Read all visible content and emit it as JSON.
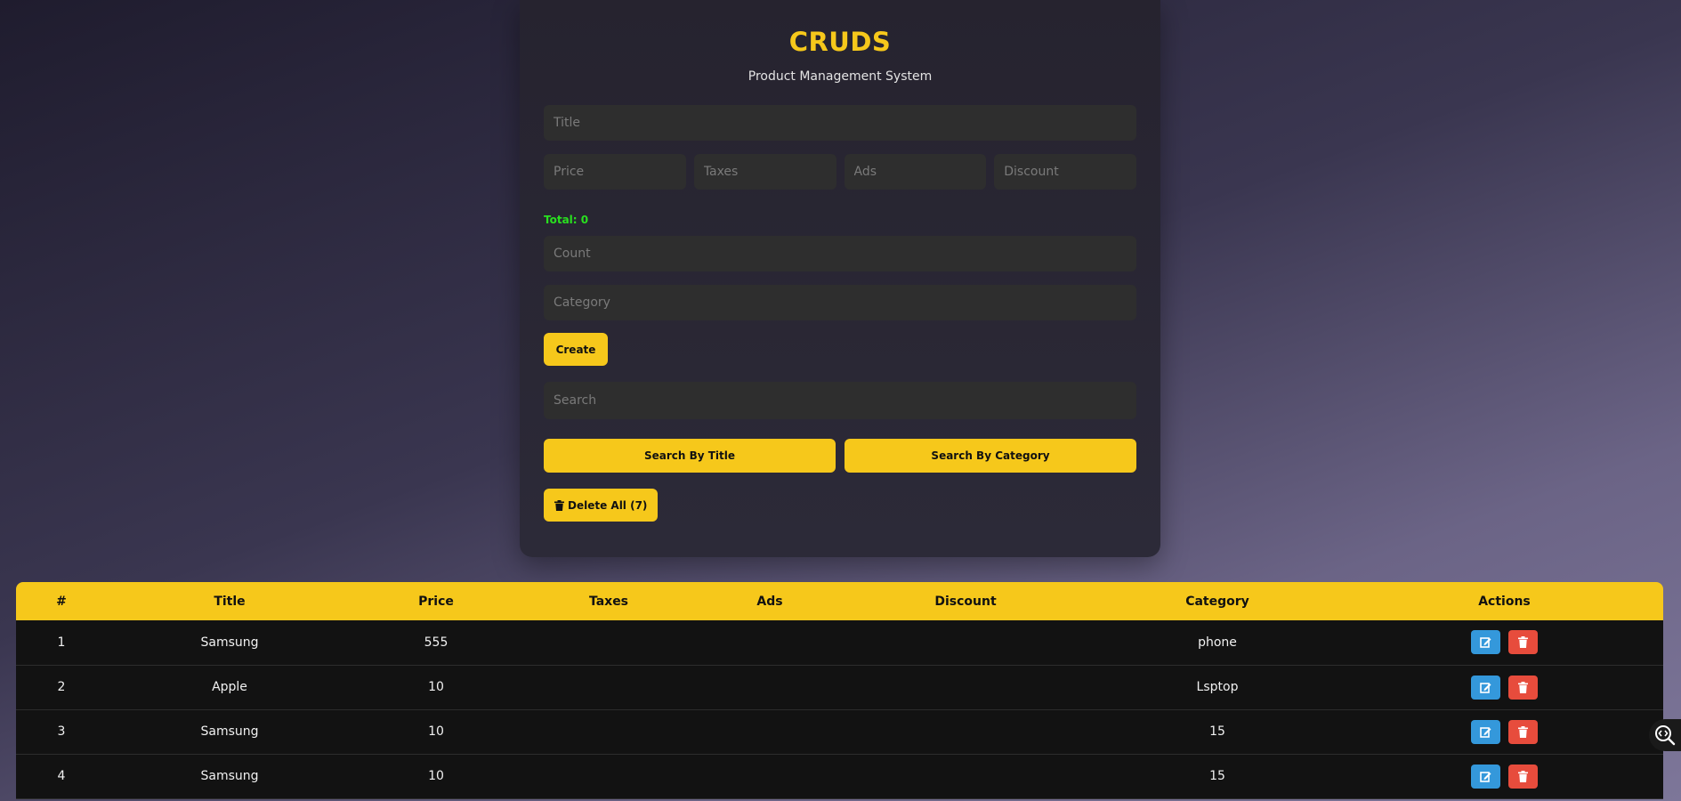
{
  "app": {
    "title": "CRUDS",
    "subtitle": "Product Management System"
  },
  "form": {
    "title_placeholder": "Title",
    "price_placeholder": "Price",
    "taxes_placeholder": "Taxes",
    "ads_placeholder": "Ads",
    "discount_placeholder": "Discount",
    "total_label": "Total: 0",
    "count_placeholder": "Count",
    "category_placeholder": "Category",
    "create_label": "Create",
    "search_placeholder": "Search",
    "search_title_label": "Search By Title",
    "search_category_label": "Search By Category",
    "delete_all_label": "Delete All (7)"
  },
  "table": {
    "headers": [
      "#",
      "Title",
      "Price",
      "Taxes",
      "Ads",
      "Discount",
      "Category",
      "Actions"
    ],
    "rows": [
      {
        "id": "1",
        "title": "Samsung",
        "price": "555",
        "taxes": "",
        "ads": "",
        "discount": "",
        "category": "phone"
      },
      {
        "id": "2",
        "title": "Apple",
        "price": "10",
        "taxes": "",
        "ads": "",
        "discount": "",
        "category": "Lsptop"
      },
      {
        "id": "3",
        "title": "Samsung",
        "price": "10",
        "taxes": "",
        "ads": "",
        "discount": "",
        "category": "15"
      },
      {
        "id": "4",
        "title": "Samsung",
        "price": "10",
        "taxes": "",
        "ads": "",
        "discount": "",
        "category": "15"
      }
    ]
  },
  "colors": {
    "accent": "#f6c81b",
    "total": "#29e01f",
    "edit": "#3498db",
    "delete": "#e74c3c"
  },
  "icons": {
    "delete_all": "trash-icon",
    "edit": "edit-icon",
    "delete": "trash-icon",
    "floating": "code-search-icon"
  }
}
